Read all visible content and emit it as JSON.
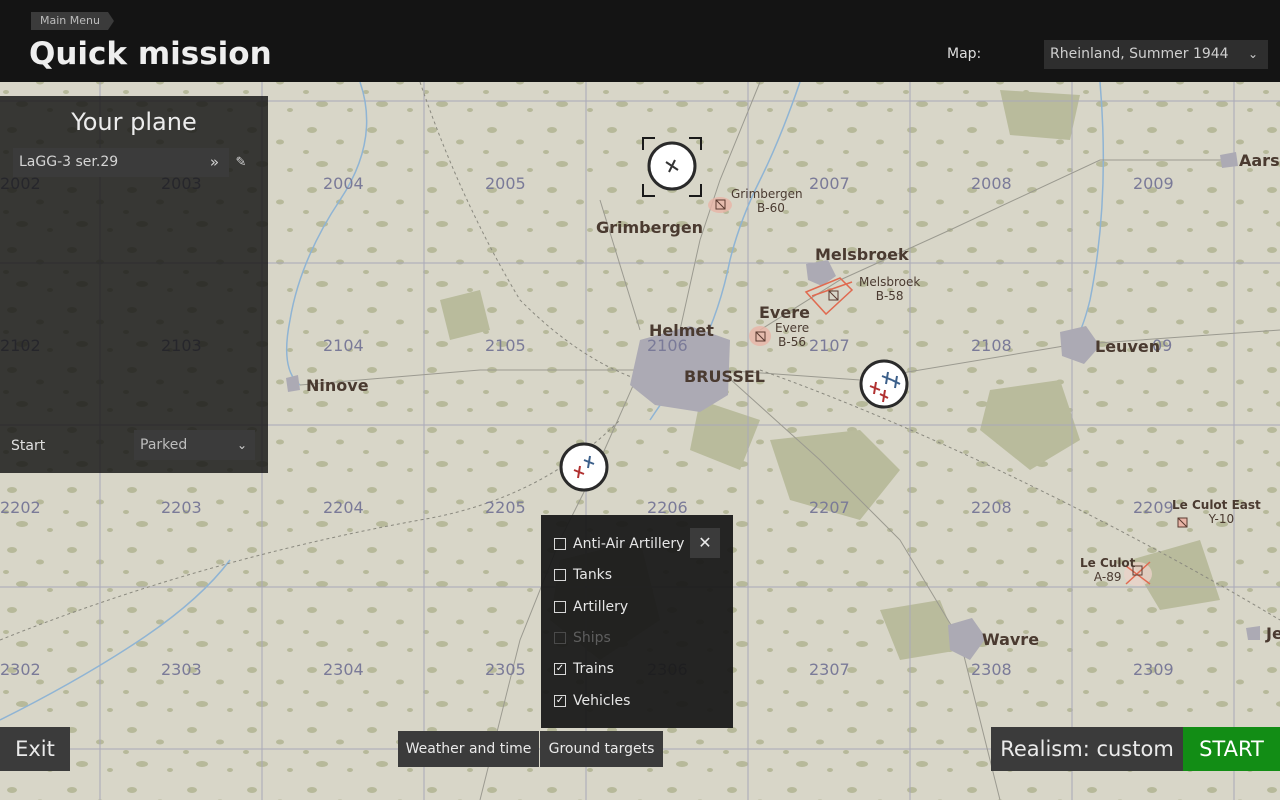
{
  "header": {
    "breadcrumb": "Main Menu",
    "title": "Quick mission",
    "map_label": "Map:",
    "map_value": "Rheinland, Summer 1944"
  },
  "plane_panel": {
    "title": "Your plane",
    "plane_value": "LaGG-3 ser.29",
    "start_label": "Start",
    "start_value": "Parked"
  },
  "map": {
    "grid_labels": [
      "2002",
      "2003",
      "2004",
      "2005",
      "2007",
      "2008",
      "2009",
      "2102",
      "2103",
      "2104",
      "2105",
      "2106",
      "2107",
      "2108",
      "09",
      "2202",
      "2203",
      "2204",
      "2205",
      "2206",
      "2207",
      "2208",
      "2209",
      "2302",
      "2303",
      "2304",
      "2305",
      "2306",
      "2307",
      "2308",
      "2309"
    ],
    "cities": [
      "Grimbergen",
      "Melsbroek",
      "Evere",
      "Helmet",
      "BRUSSEL",
      "Ninove",
      "Leuven",
      "Wavre",
      "Aarsc",
      "Je"
    ],
    "airfields": [
      {
        "name": "Grimbergen",
        "code": "B-60"
      },
      {
        "name": "Melsbroek",
        "code": "B-58"
      },
      {
        "name": "Evere",
        "code": "B-56"
      },
      {
        "name": "Le Culot East",
        "code": "Y-10"
      },
      {
        "name": "Le Culot",
        "code": "A-89"
      }
    ]
  },
  "ground_targets": {
    "items": [
      {
        "label": "Anti-Air Artillery",
        "checked": false,
        "disabled": false
      },
      {
        "label": "Tanks",
        "checked": false,
        "disabled": false
      },
      {
        "label": "Artillery",
        "checked": false,
        "disabled": false
      },
      {
        "label": "Ships",
        "checked": false,
        "disabled": true
      },
      {
        "label": "Trains",
        "checked": true,
        "disabled": false
      },
      {
        "label": "Vehicles",
        "checked": true,
        "disabled": false
      }
    ]
  },
  "footer": {
    "exit_label": "Exit",
    "weather_label": "Weather and time",
    "ground_targets_label": "Ground targets",
    "realism_label": "Realism: custom",
    "start_label": "START"
  },
  "colors": {
    "start_button": "#128d15",
    "header_bg": "#141414",
    "map_bg": "#d8d6c8"
  }
}
